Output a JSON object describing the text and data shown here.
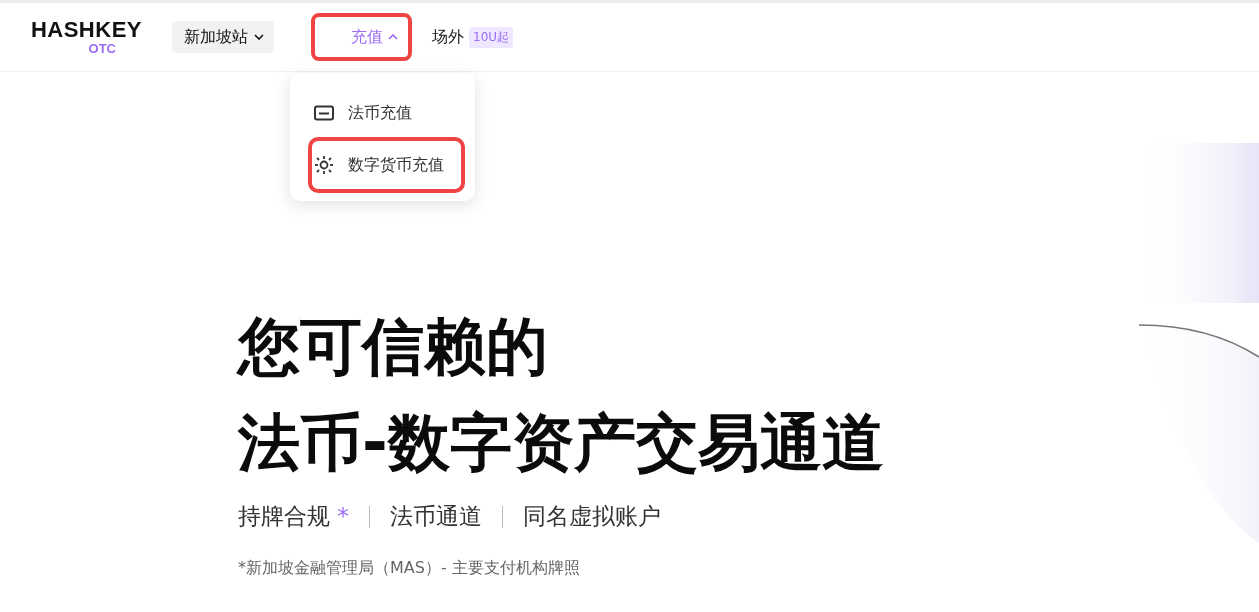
{
  "header": {
    "logo": {
      "name": "HASHKEY",
      "sub": "OTC"
    },
    "region": {
      "label": "新加坡站"
    },
    "nav": [
      {
        "label": "充值",
        "expanded": true,
        "highlighted": true
      },
      {
        "label": "场外",
        "badge": "10U起",
        "expanded": false,
        "highlighted": false
      }
    ]
  },
  "dropdown": {
    "items": [
      {
        "kind": "card",
        "label": "法币充值",
        "highlighted": false
      },
      {
        "kind": "crypto",
        "label": "数字货币充值",
        "highlighted": true
      }
    ]
  },
  "hero": {
    "title_lines": [
      "您可信赖的",
      "法币-数字资产交易通道"
    ],
    "features": [
      {
        "label": "持牌合规",
        "mark": "*"
      },
      {
        "label": "法币通道"
      },
      {
        "label": "同名虚拟账户"
      }
    ],
    "footnote": "*新加坡金融管理局（MAS）- 主要支付机构牌照"
  }
}
